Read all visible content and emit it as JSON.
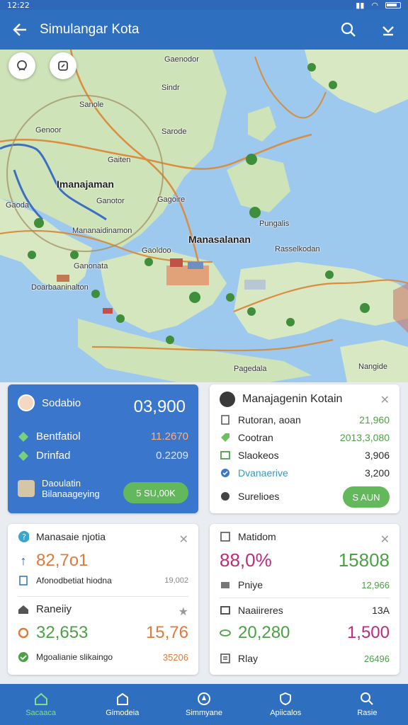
{
  "status": {
    "time": "12:22"
  },
  "appbar": {
    "title": "Simulangar Kota",
    "back_icon": "arrow-left-icon",
    "search_icon": "search-icon",
    "menu_icon": "chevron-down-icon"
  },
  "map": {
    "labels": [
      "Gaenodor",
      "Sindr",
      "Sanole",
      "Sarode",
      "Genoor",
      "Gaiten",
      "Imanajaman",
      "Ganotor",
      "Gagoire",
      "Gaoda",
      "Mananaidinamon",
      "Manasalanan",
      "Rasselkodan",
      "Doarbaaninalton",
      "Gaoldoo",
      "Ganonata",
      "Pungalis",
      "Pagedala",
      "Nangide"
    ],
    "water_color": "#9ec9ee",
    "land_color": "#cfe3b9",
    "road_color": "#d98d3e",
    "route_color": "#3c6fc4"
  },
  "card_population": {
    "title": "Sodabio",
    "value": "03,900",
    "rows": [
      {
        "label": "Bentfatiol",
        "value": "11.2670"
      },
      {
        "label": "Drinfad",
        "value": "0.2209"
      }
    ],
    "footer_line1": "Daoulatin",
    "footer_line2": "Bilanaageying",
    "button": "5 SU,00K"
  },
  "card_management": {
    "title": "Manajagenin Kotain",
    "rows": [
      {
        "label": "Rutoran, aoan",
        "value": "21,960"
      },
      {
        "label": "Cootran",
        "value": "2013,3,080"
      },
      {
        "label": "Slaokeos",
        "value": "3,906"
      },
      {
        "label": "Dvanaerive",
        "value": "3,200"
      }
    ],
    "footer_label": "Surelioes",
    "button": "S AUN"
  },
  "card_stats_left": {
    "title": "Manasaie njotia",
    "big_value": "82,7o1",
    "row_label": "Afonodbetiat hiodna",
    "row_value": "19,002",
    "section_title": "Raneiiy",
    "value_a": "32,653",
    "value_b": "15,76",
    "footer_label": "Mgoalianie slikaingo",
    "footer_value": "35206"
  },
  "card_stats_right": {
    "title": "Matidom",
    "percent": "88,0%",
    "big_value": "15808",
    "row1_label": "Pniye",
    "row1_value": "12,966",
    "row2_label": "Naaiireres",
    "row2_value": "13A",
    "value_a": "20,280",
    "value_b": "1,500",
    "footer_label": "Rlay",
    "footer_value": "26496"
  },
  "bottom_nav": [
    {
      "label": "Sacaaca",
      "icon": "home-icon",
      "active": true
    },
    {
      "label": "Gimodeia",
      "icon": "city-icon",
      "active": false
    },
    {
      "label": "Simmyane",
      "icon": "compass-icon",
      "active": false
    },
    {
      "label": "Apiicalos",
      "icon": "shield-icon",
      "active": false
    },
    {
      "label": "Rasie",
      "icon": "search-icon",
      "active": false
    }
  ]
}
